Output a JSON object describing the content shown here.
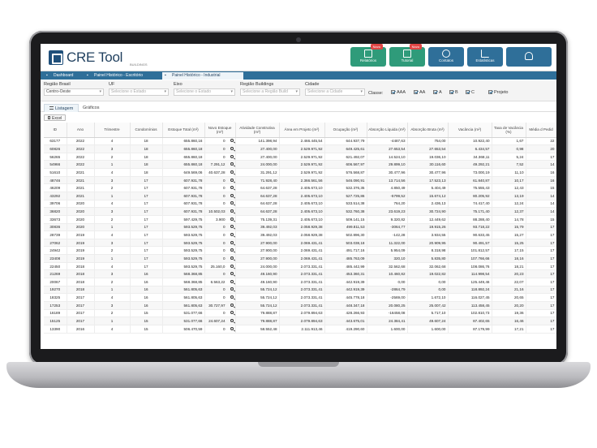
{
  "app": {
    "logo_text": "CRE Tool",
    "logo_sub": "BUILDINGS"
  },
  "top_buttons": [
    {
      "label": "Relatórios",
      "badge": "Novo",
      "icon": "report-icon",
      "color": "#2f9b7a"
    },
    {
      "label": "Tutorial",
      "badge": "Novo",
      "icon": "tutorial-icon",
      "color": "#2f9b7a"
    },
    {
      "label": "Contatos",
      "badge": "",
      "icon": "contacts-icon",
      "color": "#2f6f99"
    },
    {
      "label": "Estatísticas",
      "badge": "",
      "icon": "stats-icon",
      "color": "#2f6f99"
    },
    {
      "label": "",
      "badge": "",
      "icon": "user-icon",
      "color": "#2f6f99"
    }
  ],
  "tabs": [
    {
      "label": "Dashboard"
    },
    {
      "label": "Painel Histórico - Escritório"
    },
    {
      "label": "Painel Histórico - Industrial"
    }
  ],
  "filters": {
    "regiao_brasil": {
      "label": "Região Brasil",
      "value": "Centro-Oeste"
    },
    "uf": {
      "label": "UF",
      "placeholder": "Selecione o Estado"
    },
    "eixo": {
      "label": "Eixo",
      "placeholder": "Selecione o Estado"
    },
    "regiao_buildings": {
      "label": "Região Buildings",
      "placeholder": "Selecione a Região Build"
    },
    "cidade": {
      "label": "Cidade",
      "placeholder": "Selecione a Cidade"
    },
    "classe_label": "Classe:",
    "classes": [
      "AAA",
      "AA",
      "A",
      "B",
      "C"
    ],
    "projeto": "Projeto"
  },
  "subtabs": [
    "Listagem",
    "Gráficos"
  ],
  "excel_label": "Excel",
  "table": {
    "headers": [
      "ID",
      "Ano",
      "Trimestre",
      "Condomínios",
      "Estoque Total (m²)",
      "Novo Estoque (m²)",
      "Atividade Construtiva (m²)",
      "Área em Projeto (m²)",
      "Ocupação (m²)",
      "Absorção Líquida (m²)",
      "Absorção Bruta (m²)",
      "Vacância (m²)",
      "Taxa de Vacância (%)",
      "Média d Pedid"
    ],
    "rows": [
      [
        "63177",
        "2022",
        "4",
        "18",
        "655.860,16",
        "0",
        "141.398,94",
        "2.466.445,54",
        "644.937,79",
        "-4487,63",
        "754,00",
        "10.922,40",
        "1,67",
        "22"
      ],
      [
        "60826",
        "2022",
        "3",
        "18",
        "655.860,18",
        "0",
        "27.400,00",
        "2.529.971,92",
        "649.425,61",
        "27.653,54",
        "27.653,54",
        "6.434,57",
        "0,98",
        "20"
      ],
      [
        "56265",
        "2022",
        "2",
        "18",
        "655.860,18",
        "0",
        "27.400,00",
        "2.529.971,92",
        "621.492,07",
        "14.524,10",
        "19.036,10",
        "34.368,11",
        "5,24",
        "17"
      ],
      [
        "54966",
        "2022",
        "1",
        "18",
        "655.860,18",
        "7.291,12",
        "24.000,00",
        "2.529.971,92",
        "606.567,97",
        "29.899,10",
        "30.116,60",
        "49.292,21",
        "7,52",
        "14"
      ],
      [
        "51610",
        "2021",
        "4",
        "18",
        "649.569,06",
        "40.637,28",
        "31.291,12",
        "2.529.971,92",
        "576.568,87",
        "30.477,96",
        "30.477,96",
        "73.000,19",
        "11,10",
        "16"
      ],
      [
        "48746",
        "2021",
        "3",
        "17",
        "607.931,78",
        "0",
        "71.928,40",
        "2.366.561,56",
        "546.090,91",
        "13.714,56",
        "17.523,13",
        "61.840,87",
        "10,17",
        "16"
      ],
      [
        "46209",
        "2021",
        "2",
        "17",
        "607.931,78",
        "0",
        "64.637,28",
        "2.405.673,10",
        "532.376,35",
        "4.850,49",
        "5.404,49",
        "75.555,43",
        "12,43",
        "15"
      ],
      [
        "43292",
        "2021",
        "1",
        "17",
        "607.931,78",
        "0",
        "64.637,28",
        "2.405.673,10",
        "527.725,86",
        "-5799,52",
        "15.674,12",
        "80.205,92",
        "13,19",
        "14"
      ],
      [
        "39706",
        "2020",
        "4",
        "17",
        "607.931,78",
        "0",
        "64.637,28",
        "2.405.673,10",
        "533.514,38",
        "764,20",
        "2.436,13",
        "74.417,40",
        "12,24",
        "14"
      ],
      [
        "36820",
        "2020",
        "3",
        "17",
        "607.931,78",
        "10.502,03",
        "64.637,28",
        "2.405.673,10",
        "532.760,38",
        "23.619,23",
        "30.724,90",
        "75.171,40",
        "12,37",
        "14"
      ],
      [
        "33673",
        "2020",
        "2",
        "17",
        "597.429,75",
        "3.900",
        "75.139,31",
        "2.405.673,10",
        "509.141,15",
        "9.320,82",
        "12.449,62",
        "88.288,40",
        "14,78",
        "15"
      ],
      [
        "30836",
        "2020",
        "1",
        "17",
        "593.529,75",
        "0",
        "39.492,03",
        "2.058.929,38",
        "499.811,53",
        "-3064,77",
        "19.915,26",
        "93.718,22",
        "15,79",
        "17"
      ],
      [
        "28739",
        "2019",
        "4",
        "17",
        "593.529,75",
        "0",
        "39.492,03",
        "2.058.929,38",
        "502.896,30",
        "-142,28",
        "3.934,55",
        "90.633,45",
        "15,27",
        "17"
      ],
      [
        "27062",
        "2019",
        "3",
        "17",
        "593.529,75",
        "0",
        "27.900,00",
        "2.069.431,41",
        "503.038,18",
        "11.322,00",
        "20.909,95",
        "90.491,57",
        "15,25",
        "17"
      ],
      [
        "24942",
        "2019",
        "2",
        "17",
        "593.529,75",
        "0",
        "27.900,00",
        "2.069.431,41",
        "491.717,16",
        "5.954,09",
        "8.318,98",
        "101.812,57",
        "17,15",
        "17"
      ],
      [
        "23408",
        "2019",
        "1",
        "17",
        "593.529,75",
        "0",
        "27.900,00",
        "2.069.431,41",
        "485.763,09",
        "320,10",
        "5.835,80",
        "107.766,66",
        "18,16",
        "17"
      ],
      [
        "22450",
        "2018",
        "4",
        "17",
        "593.529,75",
        "25.160,0",
        "24.000,00",
        "2.073.331,41",
        "485.442,99",
        "32.562,68",
        "32.062,68",
        "108.086,76",
        "18,21",
        "17"
      ],
      [
        "21269",
        "2018",
        "3",
        "16",
        "568.368,85",
        "0",
        "49.160,90",
        "2.073.331,41",
        "453.360,31",
        "10.460,82",
        "19.022,82",
        "114.998,54",
        "20,23",
        "17"
      ],
      [
        "20067",
        "2018",
        "2",
        "16",
        "568.368,85",
        "6.563,22",
        "49.160,90",
        "2.073.331,41",
        "442.919,39",
        "0,00",
        "0,00",
        "125.449,46",
        "22,07",
        "17"
      ],
      [
        "19270",
        "2018",
        "1",
        "16",
        "561.805,63",
        "0",
        "55.724,12",
        "2.073.331,41",
        "442.919,39",
        "-2864,79",
        "0,00",
        "118.892,24",
        "21,16",
        "17"
      ],
      [
        "18325",
        "2017",
        "4",
        "16",
        "561.805,63",
        "0",
        "55.724,12",
        "2.073.331,41",
        "445.778,18",
        "-2569,00",
        "1.672,10",
        "116.027,45",
        "20,65",
        "17"
      ],
      [
        "17253",
        "2017",
        "3",
        "16",
        "561.805,63",
        "30.727,97",
        "55.724,12",
        "2.073.331,41",
        "448.347,18",
        "20.080,25",
        "25.007,42",
        "113.458,45",
        "20,20",
        "17"
      ],
      [
        "16189",
        "2017",
        "2",
        "15",
        "531.077,66",
        "0",
        "79.888,87",
        "2.079.894,63",
        "428.266,93",
        "-16458,08",
        "5.717,10",
        "102.810,73",
        "19,36",
        "17"
      ],
      [
        "15125",
        "2017",
        "1",
        "15",
        "531.077,66",
        "24.607,24",
        "79.888,87",
        "2.079.894,63",
        "443.675,01",
        "24.384,41",
        "49.607,24",
        "87.402,65",
        "16,46",
        "17"
      ],
      [
        "13390",
        "2016",
        "4",
        "15",
        "506.470,59",
        "0",
        "58.552,48",
        "2.111.913,46",
        "419.290,60",
        "1.600,00",
        "1.600,00",
        "87.179,99",
        "17,21",
        "17"
      ]
    ]
  }
}
